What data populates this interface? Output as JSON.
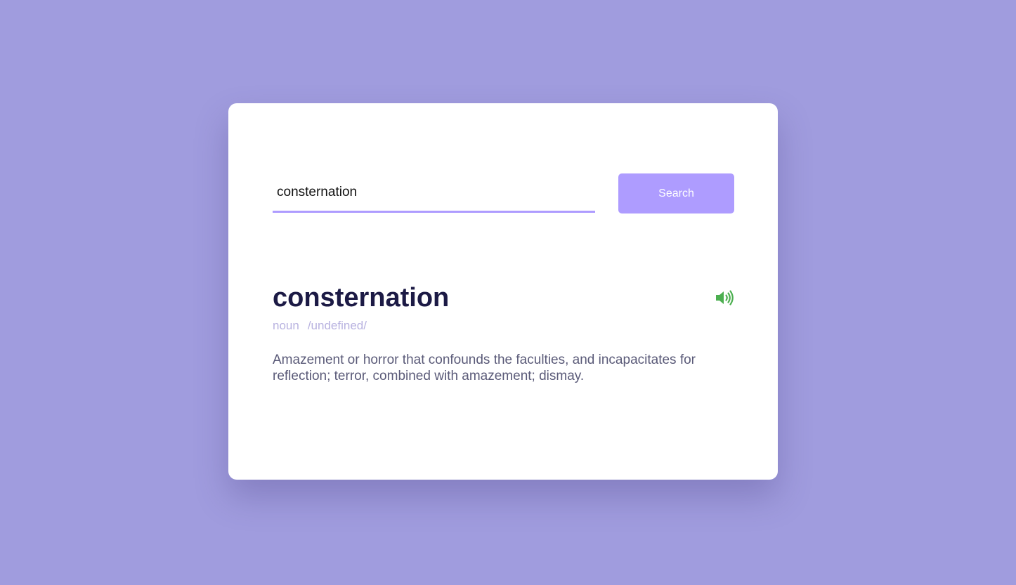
{
  "search": {
    "value": "consternation",
    "button_label": "Search"
  },
  "result": {
    "word": "consternation",
    "part_of_speech": "noun",
    "phonetic": "/undefined/",
    "definition": "Amazement or horror that confounds the faculties, and incapacitates for reflection; terror, combined with amazement; dismay.",
    "sound_icon": "volume-icon"
  },
  "colors": {
    "background": "#a09cde",
    "card": "#ffffff",
    "accent": "#ae9cff",
    "word": "#1c1a45",
    "meta": "#b8b2e0",
    "definition": "#5a5a78",
    "sound_icon": "#4caf50"
  }
}
